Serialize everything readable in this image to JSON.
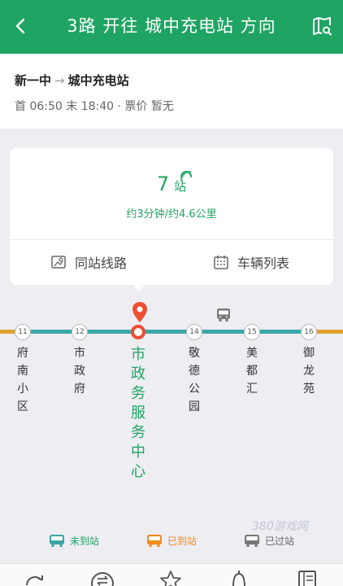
{
  "header": {
    "title": "3路 开往 城中充电站 方向"
  },
  "info": {
    "from": "新一中",
    "arrow": "→",
    "to": "城中充电站",
    "times": "首 06:50 末 18:40 · 票价 暂无"
  },
  "card": {
    "stops_num": "7",
    "stops_unit": "站",
    "eta": "约3分钟/约4.6公里",
    "same_station": "同站线路",
    "vehicle_list": "车辆列表"
  },
  "stations": [
    {
      "num": "11",
      "name": "府南小区"
    },
    {
      "num": "12",
      "name": "市政府"
    },
    {
      "num": "",
      "name": "市政务服务中心"
    },
    {
      "num": "14",
      "name": "敬德公园"
    },
    {
      "num": "15",
      "name": "美都汇"
    },
    {
      "num": "16",
      "name": "御龙苑"
    }
  ],
  "legend": {
    "not_arrived": "未到站",
    "arrived": "已到站",
    "passed": "已过站"
  },
  "watermark": "380游戏网",
  "colors": {
    "brand": "#1fa463",
    "line_teal": "#3aa6a6",
    "line_orange": "#e0a030",
    "current": "#ef4e33",
    "arrived": "#f08a1c",
    "passed": "#777777"
  }
}
